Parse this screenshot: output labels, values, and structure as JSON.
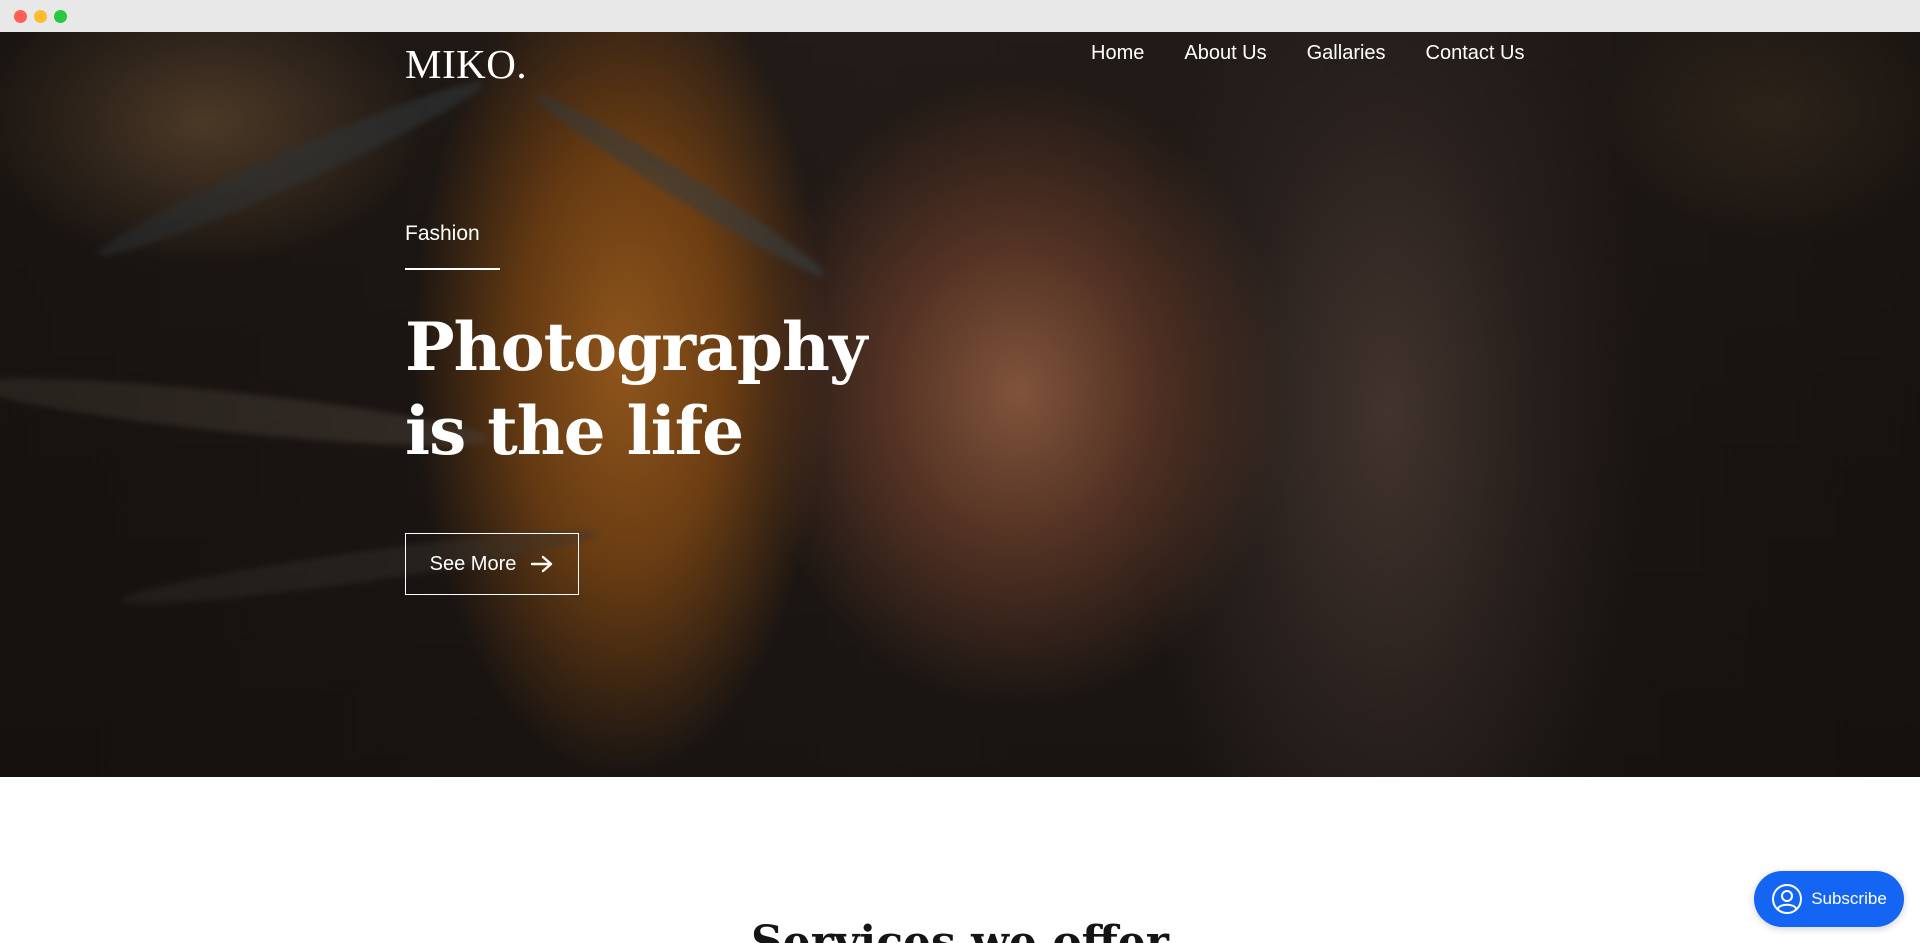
{
  "window": {
    "controls": [
      "close",
      "minimize",
      "maximize"
    ]
  },
  "header": {
    "logo": "MIKO.",
    "nav": [
      {
        "label": "Home"
      },
      {
        "label": "About Us"
      },
      {
        "label": "Gallaries"
      },
      {
        "label": "Contact Us"
      }
    ]
  },
  "hero": {
    "eyebrow": "Fashion",
    "headline_line1": "Photography",
    "headline_line2": "is the life",
    "cta_label": "See More",
    "cta_icon": "arrow-right-icon"
  },
  "services": {
    "title": "Services we offer"
  },
  "subscribe": {
    "label": "Subscribe",
    "icon": "user-circle-icon"
  },
  "colors": {
    "accent": "#1565f5",
    "hero_text": "#ffffff",
    "heading": "#151515"
  }
}
